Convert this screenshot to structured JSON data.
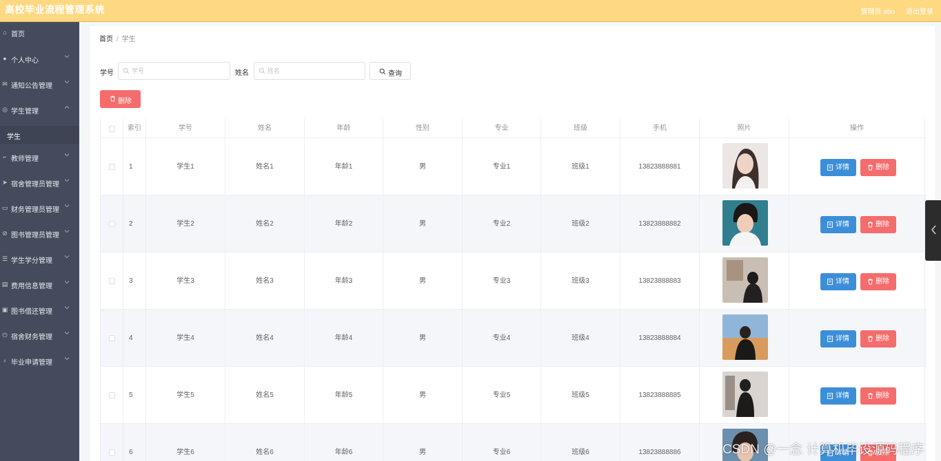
{
  "app": {
    "title": "高校毕业流程管理系统",
    "user_label": "管理员 abo",
    "logout_label": "退出登录"
  },
  "sidebar": {
    "items": [
      {
        "label": "首页",
        "icon": "home-icon",
        "has_arrow": false
      },
      {
        "label": "个人中心",
        "icon": "user-icon",
        "has_arrow": true
      },
      {
        "label": "通知公告管理",
        "icon": "mail-icon",
        "has_arrow": true
      },
      {
        "label": "学生管理",
        "icon": "compass-icon",
        "has_arrow": true,
        "expanded": true
      },
      {
        "label": "教师管理",
        "icon": "crop-icon",
        "has_arrow": true
      },
      {
        "label": "宿舍管理员管理",
        "icon": "send-icon",
        "has_arrow": true
      },
      {
        "label": "财务管理员管理",
        "icon": "card-icon",
        "has_arrow": true
      },
      {
        "label": "图书管理员管理",
        "icon": "no-sign-icon",
        "has_arrow": true
      },
      {
        "label": "学生学分管理",
        "icon": "sliders-icon",
        "has_arrow": true
      },
      {
        "label": "费用信息管理",
        "icon": "print-icon",
        "has_arrow": true
      },
      {
        "label": "图书借还管理",
        "icon": "message-icon",
        "has_arrow": true
      },
      {
        "label": "宿舍财务管理",
        "icon": "power-icon",
        "has_arrow": true
      },
      {
        "label": "毕业申请管理",
        "icon": "mic-icon",
        "has_arrow": true
      }
    ],
    "submenu": {
      "label": "学生"
    }
  },
  "breadcrumb": {
    "home": "首页",
    "separator": "/",
    "current": "学生"
  },
  "search": {
    "fields": [
      {
        "label": "学号",
        "placeholder": "学号"
      },
      {
        "label": "姓名",
        "placeholder": "姓名"
      }
    ],
    "query_label": "查询"
  },
  "batch_delete_label": "删除",
  "table": {
    "columns": [
      "索引",
      "学号",
      "姓名",
      "年龄",
      "性别",
      "专业",
      "班级",
      "手机",
      "照片",
      "操作"
    ],
    "rows": [
      {
        "index": "1",
        "id": "学生1",
        "name": "姓名1",
        "age": "年龄1",
        "gender": "男",
        "major": "专业1",
        "clazz": "班级1",
        "phone": "13823888881"
      },
      {
        "index": "2",
        "id": "学生2",
        "name": "姓名2",
        "age": "年龄2",
        "gender": "男",
        "major": "专业2",
        "clazz": "班级2",
        "phone": "13823888882"
      },
      {
        "index": "3",
        "id": "学生3",
        "name": "姓名3",
        "age": "年龄3",
        "gender": "男",
        "major": "专业3",
        "clazz": "班级3",
        "phone": "13823888883"
      },
      {
        "index": "4",
        "id": "学生4",
        "name": "姓名4",
        "age": "年龄4",
        "gender": "男",
        "major": "专业4",
        "clazz": "班级4",
        "phone": "13823888884"
      },
      {
        "index": "5",
        "id": "学生5",
        "name": "姓名5",
        "age": "年龄5",
        "gender": "男",
        "major": "专业5",
        "clazz": "班级5",
        "phone": "13823888885"
      },
      {
        "index": "6",
        "id": "学生6",
        "name": "姓名6",
        "age": "年龄6",
        "gender": "男",
        "major": "专业6",
        "clazz": "班级6",
        "phone": "13823888886"
      }
    ],
    "detail_label": "详情",
    "delete_label": "删除"
  },
  "watermark": "CSDN @一念 计算机毕设源码程序",
  "colors": {
    "topbar": "#ffd982",
    "sidebar": "#444b5c",
    "primary": "#3d8ed8",
    "danger": "#f56c6c"
  }
}
